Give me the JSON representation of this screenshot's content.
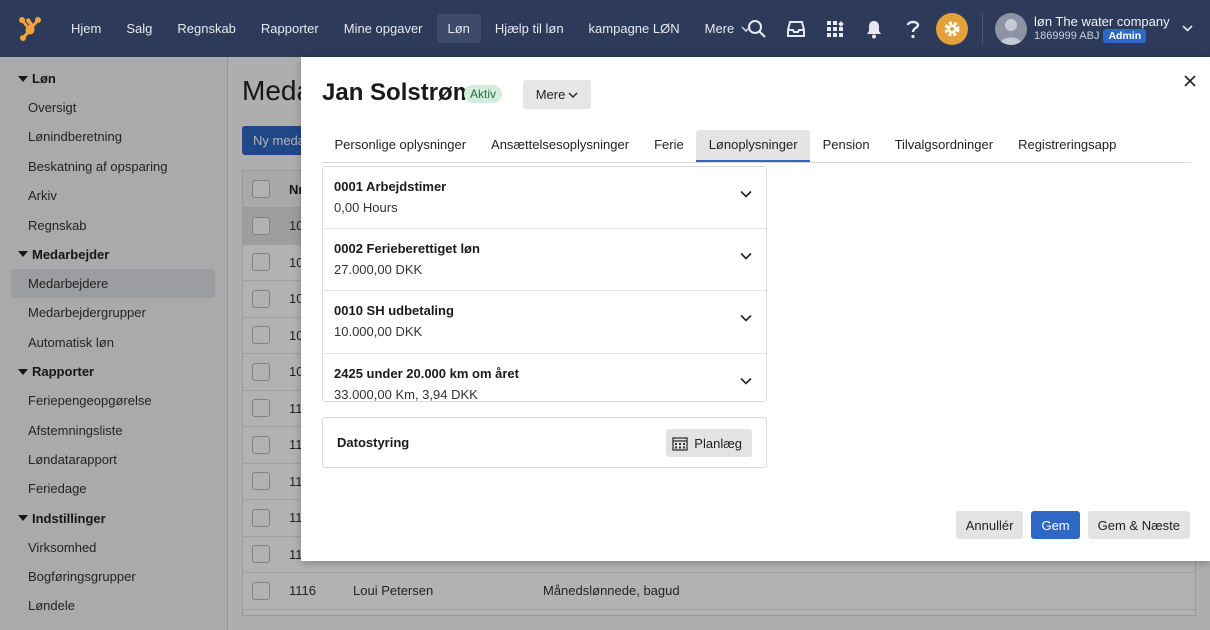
{
  "topbar": {
    "nav": [
      "Hjem",
      "Salg",
      "Regnskab",
      "Rapporter",
      "Mine opgaver",
      "Løn",
      "Hjælp til løn",
      "kampagne LØN"
    ],
    "active_nav": "Løn",
    "more_label": "Mere",
    "icons": [
      "search-icon",
      "inbox-icon",
      "apps-icon",
      "bell-icon",
      "help-icon",
      "gear-icon"
    ],
    "user": {
      "name": "løn The water company",
      "account": "1869999 ABJ",
      "role": "Admin"
    },
    "colors": {
      "bar": "#2d3a5a",
      "accent": "#2f68c4",
      "gear": "#e3a13b"
    }
  },
  "sidebar": {
    "groups": [
      {
        "label": "Løn",
        "items": [
          "Oversigt",
          "Lønindberetning",
          "Beskatning af opsparing",
          "Arkiv",
          "Regnskab"
        ]
      },
      {
        "label": "Medarbejder",
        "items": [
          "Medarbejdere",
          "Medarbejdergrupper",
          "Automatisk løn"
        ]
      },
      {
        "label": "Rapporter",
        "items": [
          "Feriepengeopgørelse",
          "Afstemningsliste",
          "Løndatarapport",
          "Feriedage"
        ]
      },
      {
        "label": "Indstillinger",
        "items": [
          "Virksomhed",
          "Bogføringsgrupper",
          "Løndele"
        ]
      }
    ],
    "active_item": "Medarbejdere"
  },
  "background": {
    "title_partial": "Meda",
    "button_partial": "Ny meda",
    "table": {
      "header_partial": "Nr",
      "rows": [
        {
          "num": "10",
          "name": "",
          "type": ""
        },
        {
          "num": "10",
          "name": "",
          "type": ""
        },
        {
          "num": "10",
          "name": "",
          "type": ""
        },
        {
          "num": "10",
          "name": "",
          "type": ""
        },
        {
          "num": "10",
          "name": "",
          "type": ""
        },
        {
          "num": "11",
          "name": "",
          "type": ""
        },
        {
          "num": "11",
          "name": "",
          "type": ""
        },
        {
          "num": "11",
          "name": "",
          "type": ""
        },
        {
          "num": "11",
          "name": "",
          "type": ""
        },
        {
          "num": "11",
          "name": "",
          "type": ""
        },
        {
          "num": "1116",
          "name": "Loui Petersen",
          "type": "Månedslønnede, bagud"
        }
      ]
    }
  },
  "modal": {
    "employee_name": "Jan Solstrøm",
    "status": "Aktiv",
    "more_label": "Mere",
    "tabs": [
      "Personlige oplysninger",
      "Ansættelsesoplysninger",
      "Ferie",
      "Lønoplysninger",
      "Pension",
      "Tilvalgsordninger",
      "Registreringsapp"
    ],
    "active_tab": "Lønoplysninger",
    "wage_items": [
      {
        "name": "0001 Arbejdstimer",
        "value": "0,00 Hours"
      },
      {
        "name": "0002 Ferieberettiget løn",
        "value": "27.000,00 DKK"
      },
      {
        "name": "0010 SH udbetaling",
        "value": "10.000,00 DKK"
      },
      {
        "name": "2425 under 20.000 km om året",
        "value": "33.000,00 Km, 3,94 DKK"
      }
    ],
    "date_control": {
      "label": "Datostyring",
      "plan_label": "Planlæg"
    },
    "footer": {
      "cancel": "Annullér",
      "save": "Gem",
      "save_next": "Gem & Næste"
    }
  }
}
